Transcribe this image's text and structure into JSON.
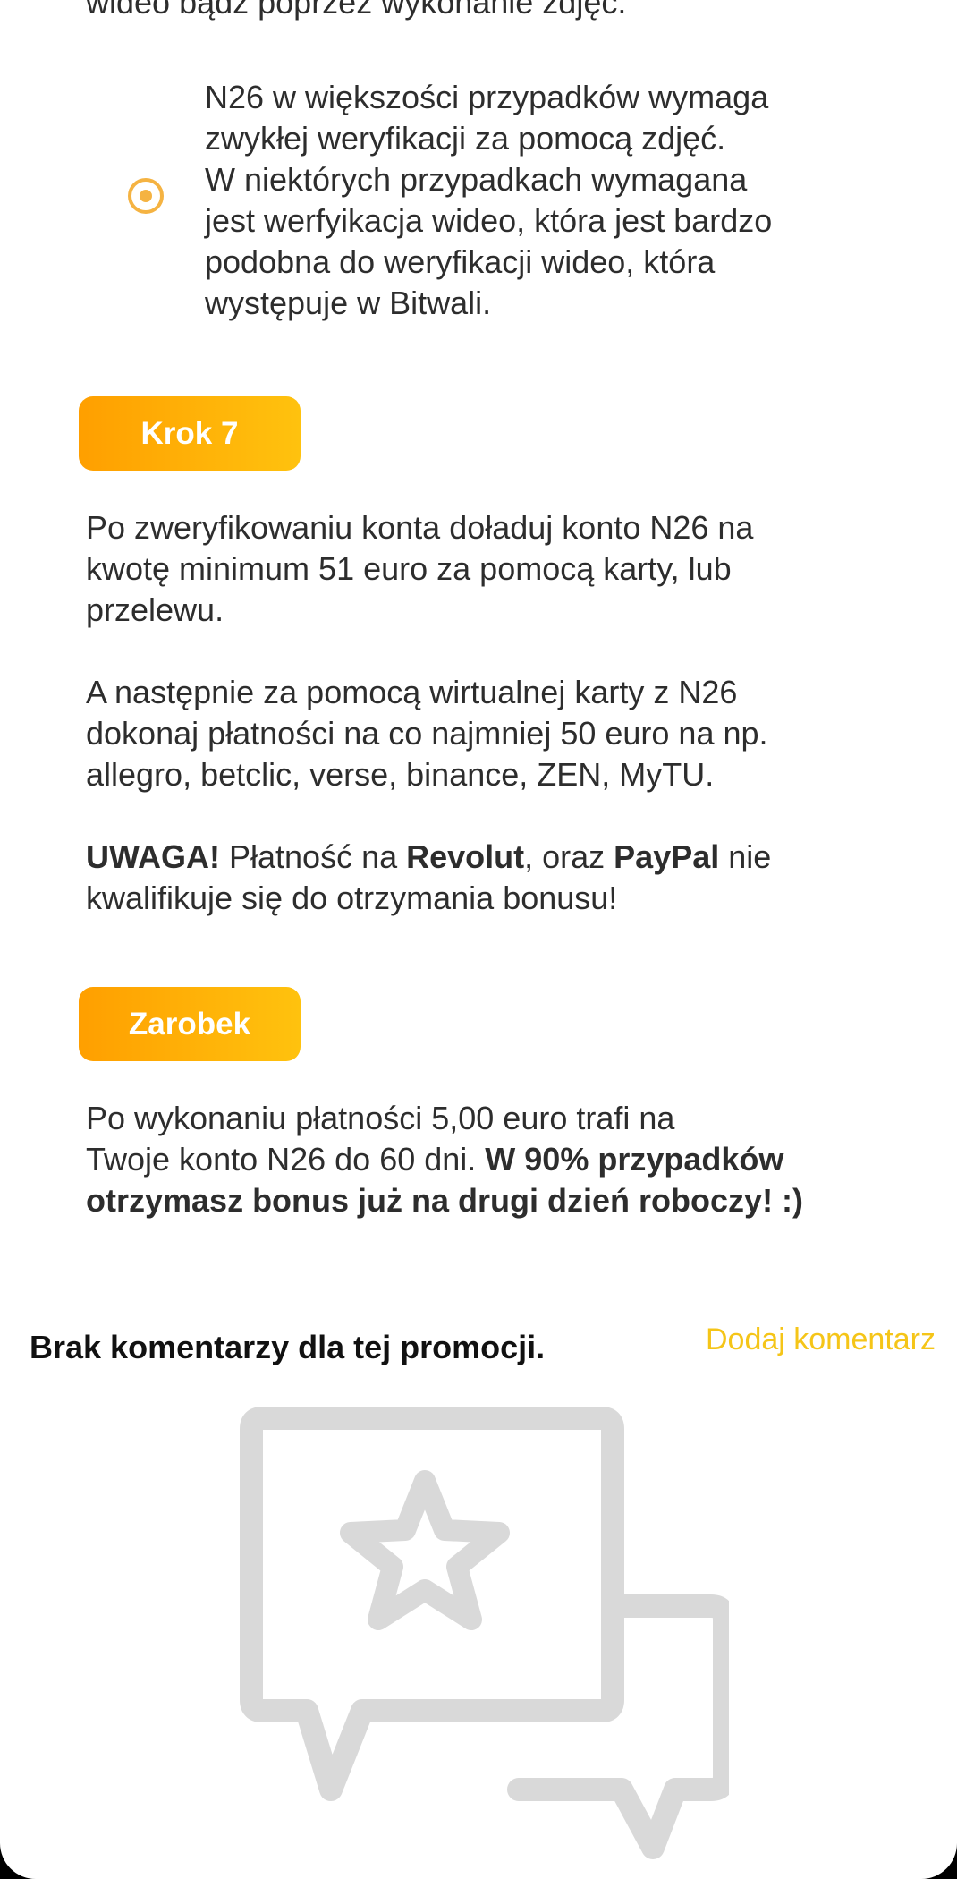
{
  "intro": {
    "tail_text": "wideo bądź poprzez wykonanie zdjęć."
  },
  "note": {
    "icon": "radio-dot-icon",
    "lines": [
      "N26 w większości przypadków wymaga",
      "zwykłej weryfikacji za pomocą zdjęć.",
      "W niektórych przypadkach wymagana",
      "jest werfyikacja wideo, która jest bardzo",
      "podobna do weryfikacji wideo, która",
      "występuje w Bitwali."
    ]
  },
  "step7": {
    "label": "Krok 7",
    "p1_lines": [
      "Po zweryfikowaniu konta doładuj konto N26 na",
      "kwotę minimum 51 euro za pomocą karty, lub",
      "przelewu."
    ],
    "p2_lines": [
      "A następnie za pomocą wirtualnej karty z N26",
      "dokonaj płatności na co najmniej 50 euro na np.",
      "allegro, betclic, verse, binance, ZEN, MyTU."
    ],
    "warning": {
      "uwaga": "UWAGA!",
      "text1": " Płatność na ",
      "revolut": "Revolut",
      "text2": ", oraz ",
      "paypal": "PayPal",
      "text3": " nie",
      "line2": "kwalifikuje się do otrzymania bonusu!"
    }
  },
  "earnings": {
    "label": "Zarobek",
    "line1": "Po wykonaniu płatności 5,00 euro trafi na",
    "line2_normal": "Twoje konto N26 do 60 dni. ",
    "line2_bold": "W 90% przypadków",
    "line3_bold": "otrzymasz bonus już na drugi dzień roboczy! :)"
  },
  "comments": {
    "empty_title": "Brak komentarzy dla tej promocji.",
    "add_label": "Dodaj komentarz",
    "illustration_icon": "comment-star-icon"
  },
  "colors": {
    "accent_gradient_start": "#ff9f00",
    "accent_gradient_end": "#ffc20e",
    "link_yellow": "#f5c518",
    "icon_orange": "#f5b342",
    "illustration_gray": "#d9d9d9"
  }
}
